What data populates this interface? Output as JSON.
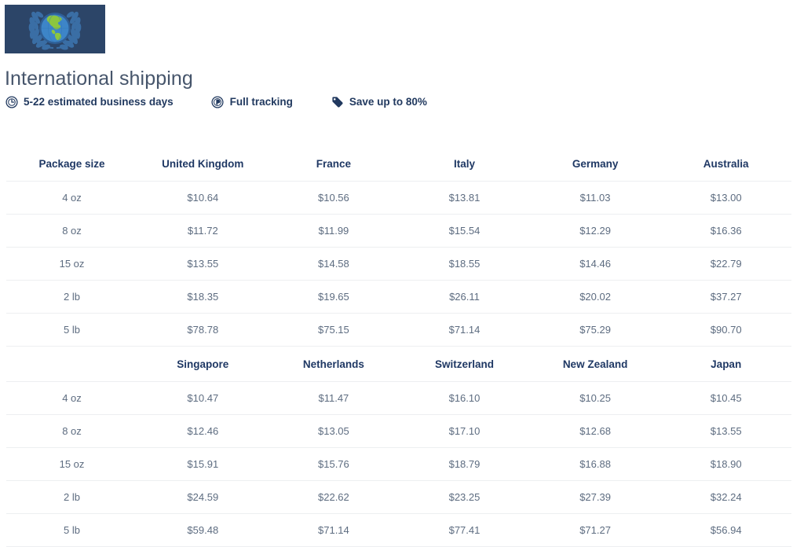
{
  "logo": {
    "name": "international-shipping-emblem",
    "background": "#2c4568",
    "globe_color": "#3d85c8",
    "land_color": "#8cc63f",
    "wreath_color": "#3a6ea5"
  },
  "header": {
    "title": "International shipping"
  },
  "badges": [
    {
      "icon": "clock-icon",
      "label": "5-22 estimated business days"
    },
    {
      "icon": "compass-icon",
      "label": "Full tracking"
    },
    {
      "icon": "price-tag-icon",
      "label": "Save up to 80%"
    }
  ],
  "colors": {
    "header_text": "#1f3864",
    "cell_text": "#5d6c80",
    "title_text": "#46556b",
    "row_divider": "#edeff1",
    "badge_text": "#21395f"
  },
  "table": {
    "size_column_header": "Package size",
    "blank_header": "",
    "blocks": [
      {
        "destinations": [
          "United Kingdom",
          "France",
          "Italy",
          "Germany",
          "Australia"
        ],
        "rows": [
          {
            "size": "4 oz",
            "prices": [
              "$10.64",
              "$10.56",
              "$13.81",
              "$11.03",
              "$13.00"
            ]
          },
          {
            "size": "8 oz",
            "prices": [
              "$11.72",
              "$11.99",
              "$15.54",
              "$12.29",
              "$16.36"
            ]
          },
          {
            "size": "15 oz",
            "prices": [
              "$13.55",
              "$14.58",
              "$18.55",
              "$14.46",
              "$22.79"
            ]
          },
          {
            "size": "2 lb",
            "prices": [
              "$18.35",
              "$19.65",
              "$26.11",
              "$20.02",
              "$37.27"
            ]
          },
          {
            "size": "5 lb",
            "prices": [
              "$78.78",
              "$75.15",
              "$71.14",
              "$75.29",
              "$90.70"
            ]
          }
        ]
      },
      {
        "destinations": [
          "Singapore",
          "Netherlands",
          "Switzerland",
          "New Zealand",
          "Japan"
        ],
        "rows": [
          {
            "size": "4 oz",
            "prices": [
              "$10.47",
              "$11.47",
              "$16.10",
              "$10.25",
              "$10.45"
            ]
          },
          {
            "size": "8 oz",
            "prices": [
              "$12.46",
              "$13.05",
              "$17.10",
              "$12.68",
              "$13.55"
            ]
          },
          {
            "size": "15 oz",
            "prices": [
              "$15.91",
              "$15.76",
              "$18.79",
              "$16.88",
              "$18.90"
            ]
          },
          {
            "size": "2 lb",
            "prices": [
              "$24.59",
              "$22.62",
              "$23.25",
              "$27.39",
              "$32.24"
            ]
          },
          {
            "size": "5 lb",
            "prices": [
              "$59.48",
              "$71.14",
              "$77.41",
              "$71.27",
              "$56.94"
            ]
          }
        ]
      }
    ]
  }
}
